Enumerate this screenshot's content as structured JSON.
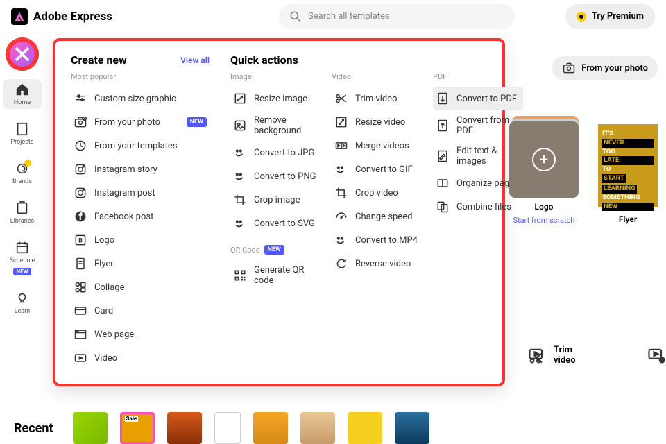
{
  "header": {
    "brand": "Adobe Express",
    "search_placeholder": "Search all templates",
    "premium_label": "Try Premium"
  },
  "sidebar": {
    "items": [
      {
        "label": "Home",
        "active": true
      },
      {
        "label": "Projects"
      },
      {
        "label": "Brands"
      },
      {
        "label": "Libraries"
      },
      {
        "label": "Schedule",
        "new": true
      },
      {
        "label": "Learn"
      }
    ]
  },
  "mega": {
    "create_title": "Create new",
    "view_all": "View all",
    "popular_sub": "Most popular",
    "popular": [
      {
        "label": "Custom size graphic"
      },
      {
        "label": "From your photo",
        "new": true
      },
      {
        "label": "From your templates"
      },
      {
        "label": "Instagram story"
      },
      {
        "label": "Instagram post"
      },
      {
        "label": "Facebook post"
      },
      {
        "label": "Logo"
      },
      {
        "label": "Flyer"
      },
      {
        "label": "Collage"
      },
      {
        "label": "Card"
      },
      {
        "label": "Web page"
      },
      {
        "label": "Video"
      }
    ],
    "qa_title": "Quick actions",
    "qa_image_sub": "Image",
    "qa_image": [
      {
        "label": "Resize image"
      },
      {
        "label": "Remove background"
      },
      {
        "label": "Convert to JPG"
      },
      {
        "label": "Convert to PNG"
      },
      {
        "label": "Crop image"
      },
      {
        "label": "Convert to SVG"
      }
    ],
    "qa_qr_sub": "QR Code",
    "qa_qr_new": "NEW",
    "qa_qr": [
      {
        "label": "Generate QR code"
      }
    ],
    "qa_video_sub": "Video",
    "qa_video": [
      {
        "label": "Trim video"
      },
      {
        "label": "Resize video"
      },
      {
        "label": "Merge videos"
      },
      {
        "label": "Convert to GIF"
      },
      {
        "label": "Crop video"
      },
      {
        "label": "Change speed"
      },
      {
        "label": "Convert to MP4"
      },
      {
        "label": "Reverse video"
      }
    ],
    "qa_pdf_sub": "PDF",
    "qa_pdf": [
      {
        "label": "Convert to PDF",
        "hover": true
      },
      {
        "label": "Convert from PDF"
      },
      {
        "label": "Edit text & images"
      },
      {
        "label": "Organize pages"
      },
      {
        "label": "Combine files"
      }
    ]
  },
  "photo_button": "From your photo",
  "cards": {
    "logo_label": "Logo",
    "logo_sub": "Start from scratch",
    "flyer_label": "Flyer",
    "flyer_lines": {
      "l1": "IT'S",
      "l2": "NEVER",
      "l3": "TOO",
      "l4": "LATE",
      "l5": "TO",
      "l6": "START",
      "l7": "LEARNING",
      "l8": "SOMETHING",
      "l9": "NEW"
    }
  },
  "qa_strip": {
    "trim": "Trim video"
  },
  "recent_title": "Recent",
  "new_badge": "NEW"
}
